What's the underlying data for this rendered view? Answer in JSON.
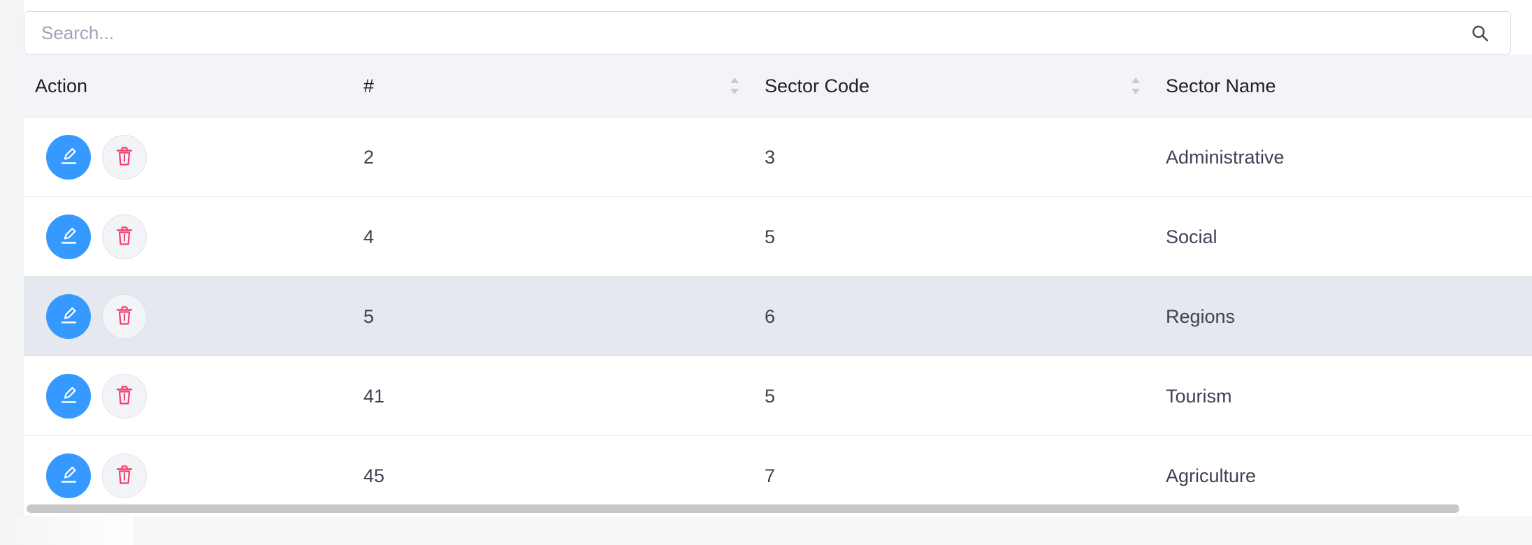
{
  "search": {
    "placeholder": "Search..."
  },
  "table": {
    "columns": [
      {
        "label": "Action",
        "sortable": false
      },
      {
        "label": "#",
        "sortable": true
      },
      {
        "label": "Sector Code",
        "sortable": true
      },
      {
        "label": "Sector Name",
        "sortable": false
      }
    ],
    "rows": [
      {
        "id": "2",
        "code": "3",
        "name": "Administrative",
        "highlighted": false
      },
      {
        "id": "4",
        "code": "5",
        "name": "Social",
        "highlighted": false
      },
      {
        "id": "5",
        "code": "6",
        "name": "Regions",
        "highlighted": true
      },
      {
        "id": "41",
        "code": "5",
        "name": "Tourism",
        "highlighted": false
      },
      {
        "id": "45",
        "code": "7",
        "name": "Agriculture",
        "highlighted": false
      }
    ]
  },
  "colors": {
    "edit_button": "#3699ff",
    "delete_icon": "#f1416c",
    "header_bg": "#f3f4f7",
    "highlight_row": "#e5e8ef"
  },
  "icons": {
    "search": "search-icon",
    "edit": "edit-icon",
    "delete": "trash-icon",
    "sort": "sort-icon"
  }
}
